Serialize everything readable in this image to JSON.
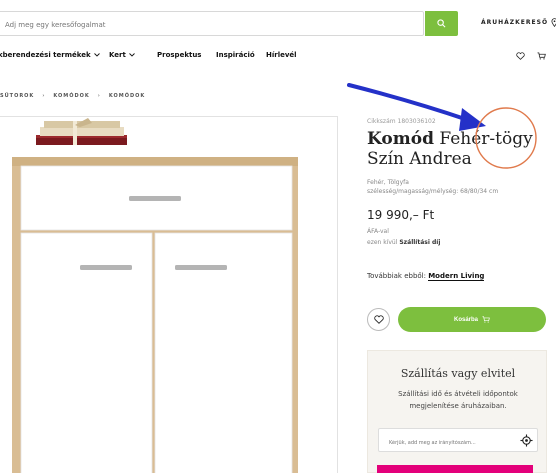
{
  "header": {
    "search_placeholder": "Adj meg egy keresőfogalmat",
    "store_label": "ÁRUHÁZKERESŐ"
  },
  "nav": {
    "items": [
      "kberendezési termékek",
      "Kert",
      "Prospektus",
      "Inspiráció",
      "Hírlevél"
    ]
  },
  "breadcrumb": [
    "SÜTOROK",
    "KOMÓDOK",
    "KOMÓDOK"
  ],
  "product": {
    "sku": "Cikkszám 1803036102",
    "title_bold": "Komód",
    "title_rest": "Fehér-tögy Szín Andrea",
    "color": "Fehér, Tölgyfa",
    "dimensions": "szélesség/magasság/mélység: 68/80/34 cm",
    "price": "19 990,– Ft",
    "vat": "ÁFA-val",
    "shipping_prefix": "ezen kívül",
    "shipping_link": "Szállítási díj",
    "more_from_prefix": "Továbbiak ebből:",
    "more_from_brand": "Modern Living",
    "cart_label": "Kosárba"
  },
  "delivery": {
    "title": "Szállítás vagy elvitel",
    "text": "Szállítási idő és átvételi időpontok megjelenítése áruházaiban.",
    "zip_placeholder": "Kérjük, add meg az irányítószám..."
  },
  "colors": {
    "accent_green": "#7dbf3e",
    "annotation_blue": "#2431c8",
    "annotation_orange": "#e07a4c",
    "pink": "#e3007a"
  }
}
